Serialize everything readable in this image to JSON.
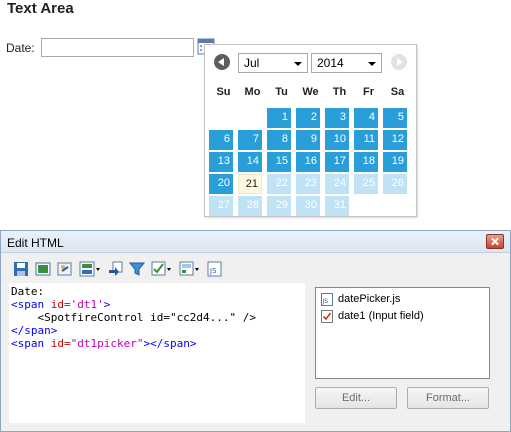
{
  "text_area": {
    "title": "Text Area",
    "date_label": "Date:",
    "date_value": ""
  },
  "datepicker": {
    "month": "Jul",
    "year": "2014",
    "weekdays": [
      "Mo",
      "Tu",
      "We",
      "Th",
      "Fr",
      "Sa"
    ],
    "su_label": "Su",
    "rows": [
      [
        "",
        "",
        "1",
        "2",
        "3",
        "4",
        "5"
      ],
      [
        "6",
        "7",
        "8",
        "9",
        "10",
        "11",
        "12"
      ],
      [
        "13",
        "14",
        "15",
        "16",
        "17",
        "18",
        "19"
      ],
      [
        "20",
        "21",
        "22",
        "23",
        "24",
        "25",
        "26"
      ],
      [
        "27",
        "28",
        "29",
        "30",
        "31",
        "",
        ""
      ]
    ],
    "today": "21",
    "colors": {
      "current": "#2a9ed8",
      "future": "#bfe2f5",
      "today": "#fdf8e4"
    }
  },
  "dialog": {
    "title": "Edit HTML",
    "toolbar_icons": [
      "save-icon",
      "insert-image-icon",
      "insert-link-icon",
      "insert-control-icon",
      "insert-property-icon",
      "insert-filter-icon",
      "insert-action-icon",
      "insert-calculated-value-icon",
      "insert-javascript-icon"
    ],
    "code": [
      {
        "segments": [
          {
            "text": "Date:",
            "color": "black"
          }
        ]
      },
      {
        "segments": [
          {
            "text": "<span ",
            "color": "blue"
          },
          {
            "text": "id=",
            "color": "red"
          },
          {
            "text": "'dt1'",
            "color": "mag"
          },
          {
            "text": ">",
            "color": "blue"
          }
        ]
      },
      {
        "segments": [
          {
            "text": "    <SpotfireControl id=\"cc2d4...\" />",
            "color": "black"
          }
        ]
      },
      {
        "segments": [
          {
            "text": "</span>",
            "color": "blue"
          }
        ]
      },
      {
        "segments": [
          {
            "text": "<span ",
            "color": "blue"
          },
          {
            "text": "id=",
            "color": "red"
          },
          {
            "text": "\"dt1picker\"",
            "color": "mag"
          },
          {
            "text": "></span>",
            "color": "blue"
          }
        ]
      }
    ],
    "files": [
      {
        "label": "datePicker.js",
        "icon": "javascript-file-icon"
      },
      {
        "label": "date1 (Input field)",
        "icon": "input-field-icon"
      }
    ],
    "edit_button": "Edit...",
    "format_button": "Format..."
  }
}
